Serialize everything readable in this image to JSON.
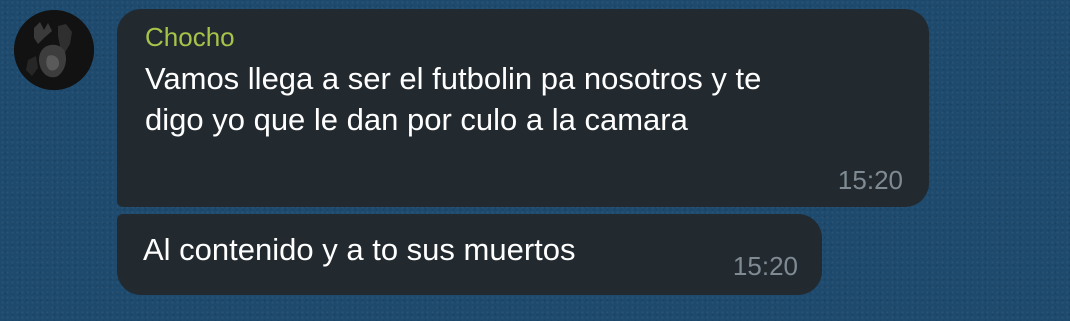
{
  "chat": {
    "messages": [
      {
        "sender": "Chocho",
        "lines": [
          "Vamos llega a ser el futbolin pa nosotros y te",
          "digo yo que le dan por culo a la camara"
        ],
        "time": "15:20"
      },
      {
        "text": "Al contenido y a to sus muertos",
        "time": "15:20"
      }
    ]
  },
  "colors": {
    "background": "#1e4a6e",
    "bubble": "#222a30",
    "sender_name": "#a6c34a",
    "timestamp": "#7f8a92",
    "text": "#ffffff"
  },
  "icons": {
    "avatar": "sender-avatar"
  }
}
